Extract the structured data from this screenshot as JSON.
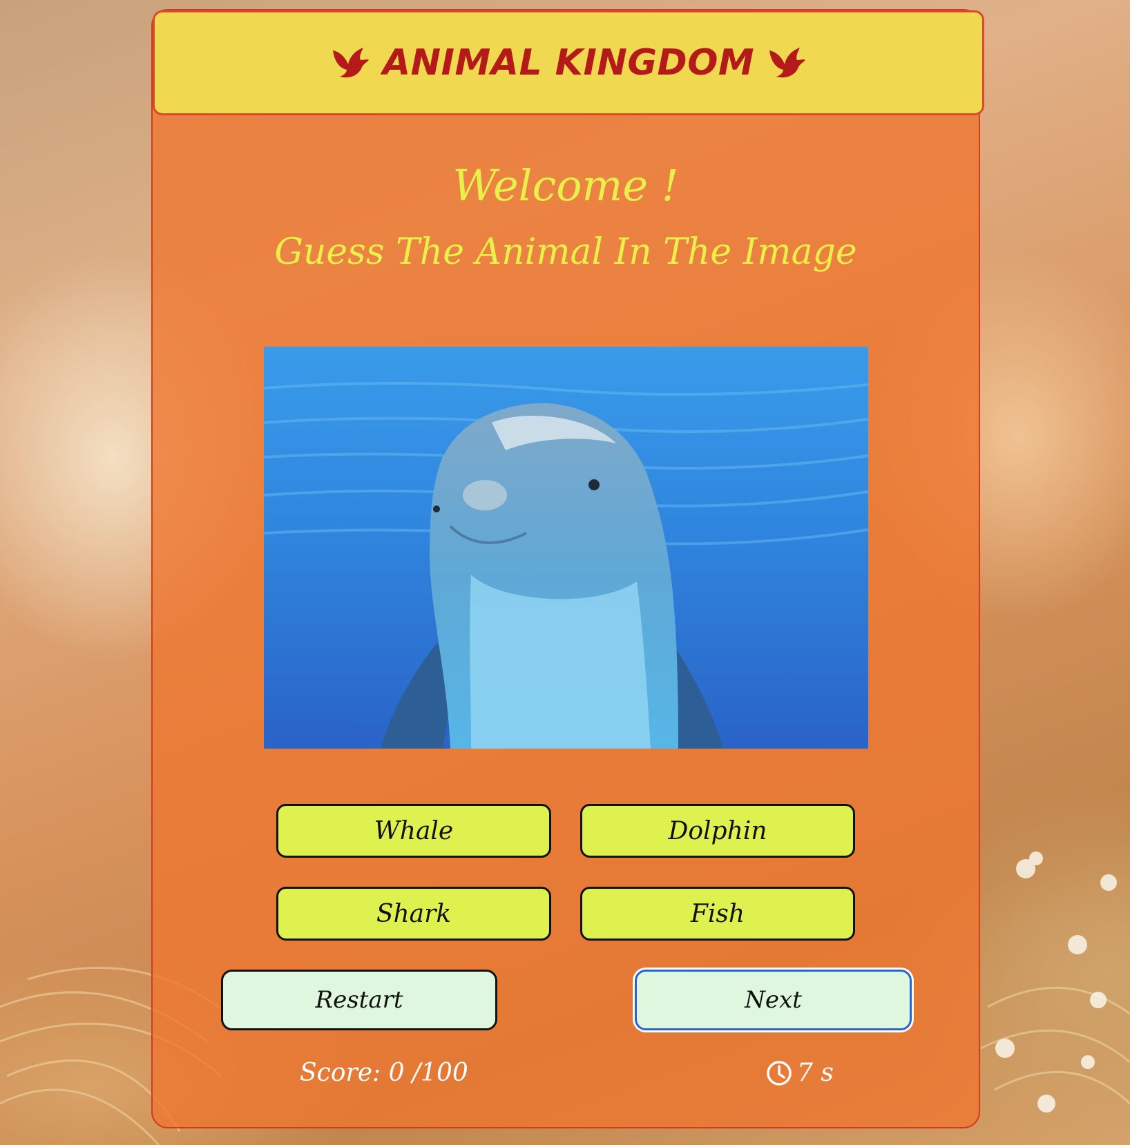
{
  "header": {
    "title": "ANIMAL KINGDOM",
    "left_icon": "dove-icon",
    "right_icon": "dove-icon"
  },
  "intro": {
    "welcome": "Welcome !",
    "subtitle": "Guess The Animal In The Image"
  },
  "question": {
    "image_subject": "dolphin underwater",
    "answers": [
      "Whale",
      "Dolphin",
      "Shark",
      "Fish"
    ]
  },
  "controls": {
    "restart_label": "Restart",
    "next_label": "Next"
  },
  "status": {
    "score": "Score: 0 /100",
    "timer_icon": "clock-icon",
    "timer": "7 s"
  },
  "colors": {
    "header_bg": "#f1d851",
    "header_text": "#b41a1a",
    "card_bg": "#ee7630",
    "heading_text": "#eaf04a",
    "answer_bg": "#def14e",
    "control_bg": "#dff7df",
    "focus_ring": "#2a63d6"
  }
}
